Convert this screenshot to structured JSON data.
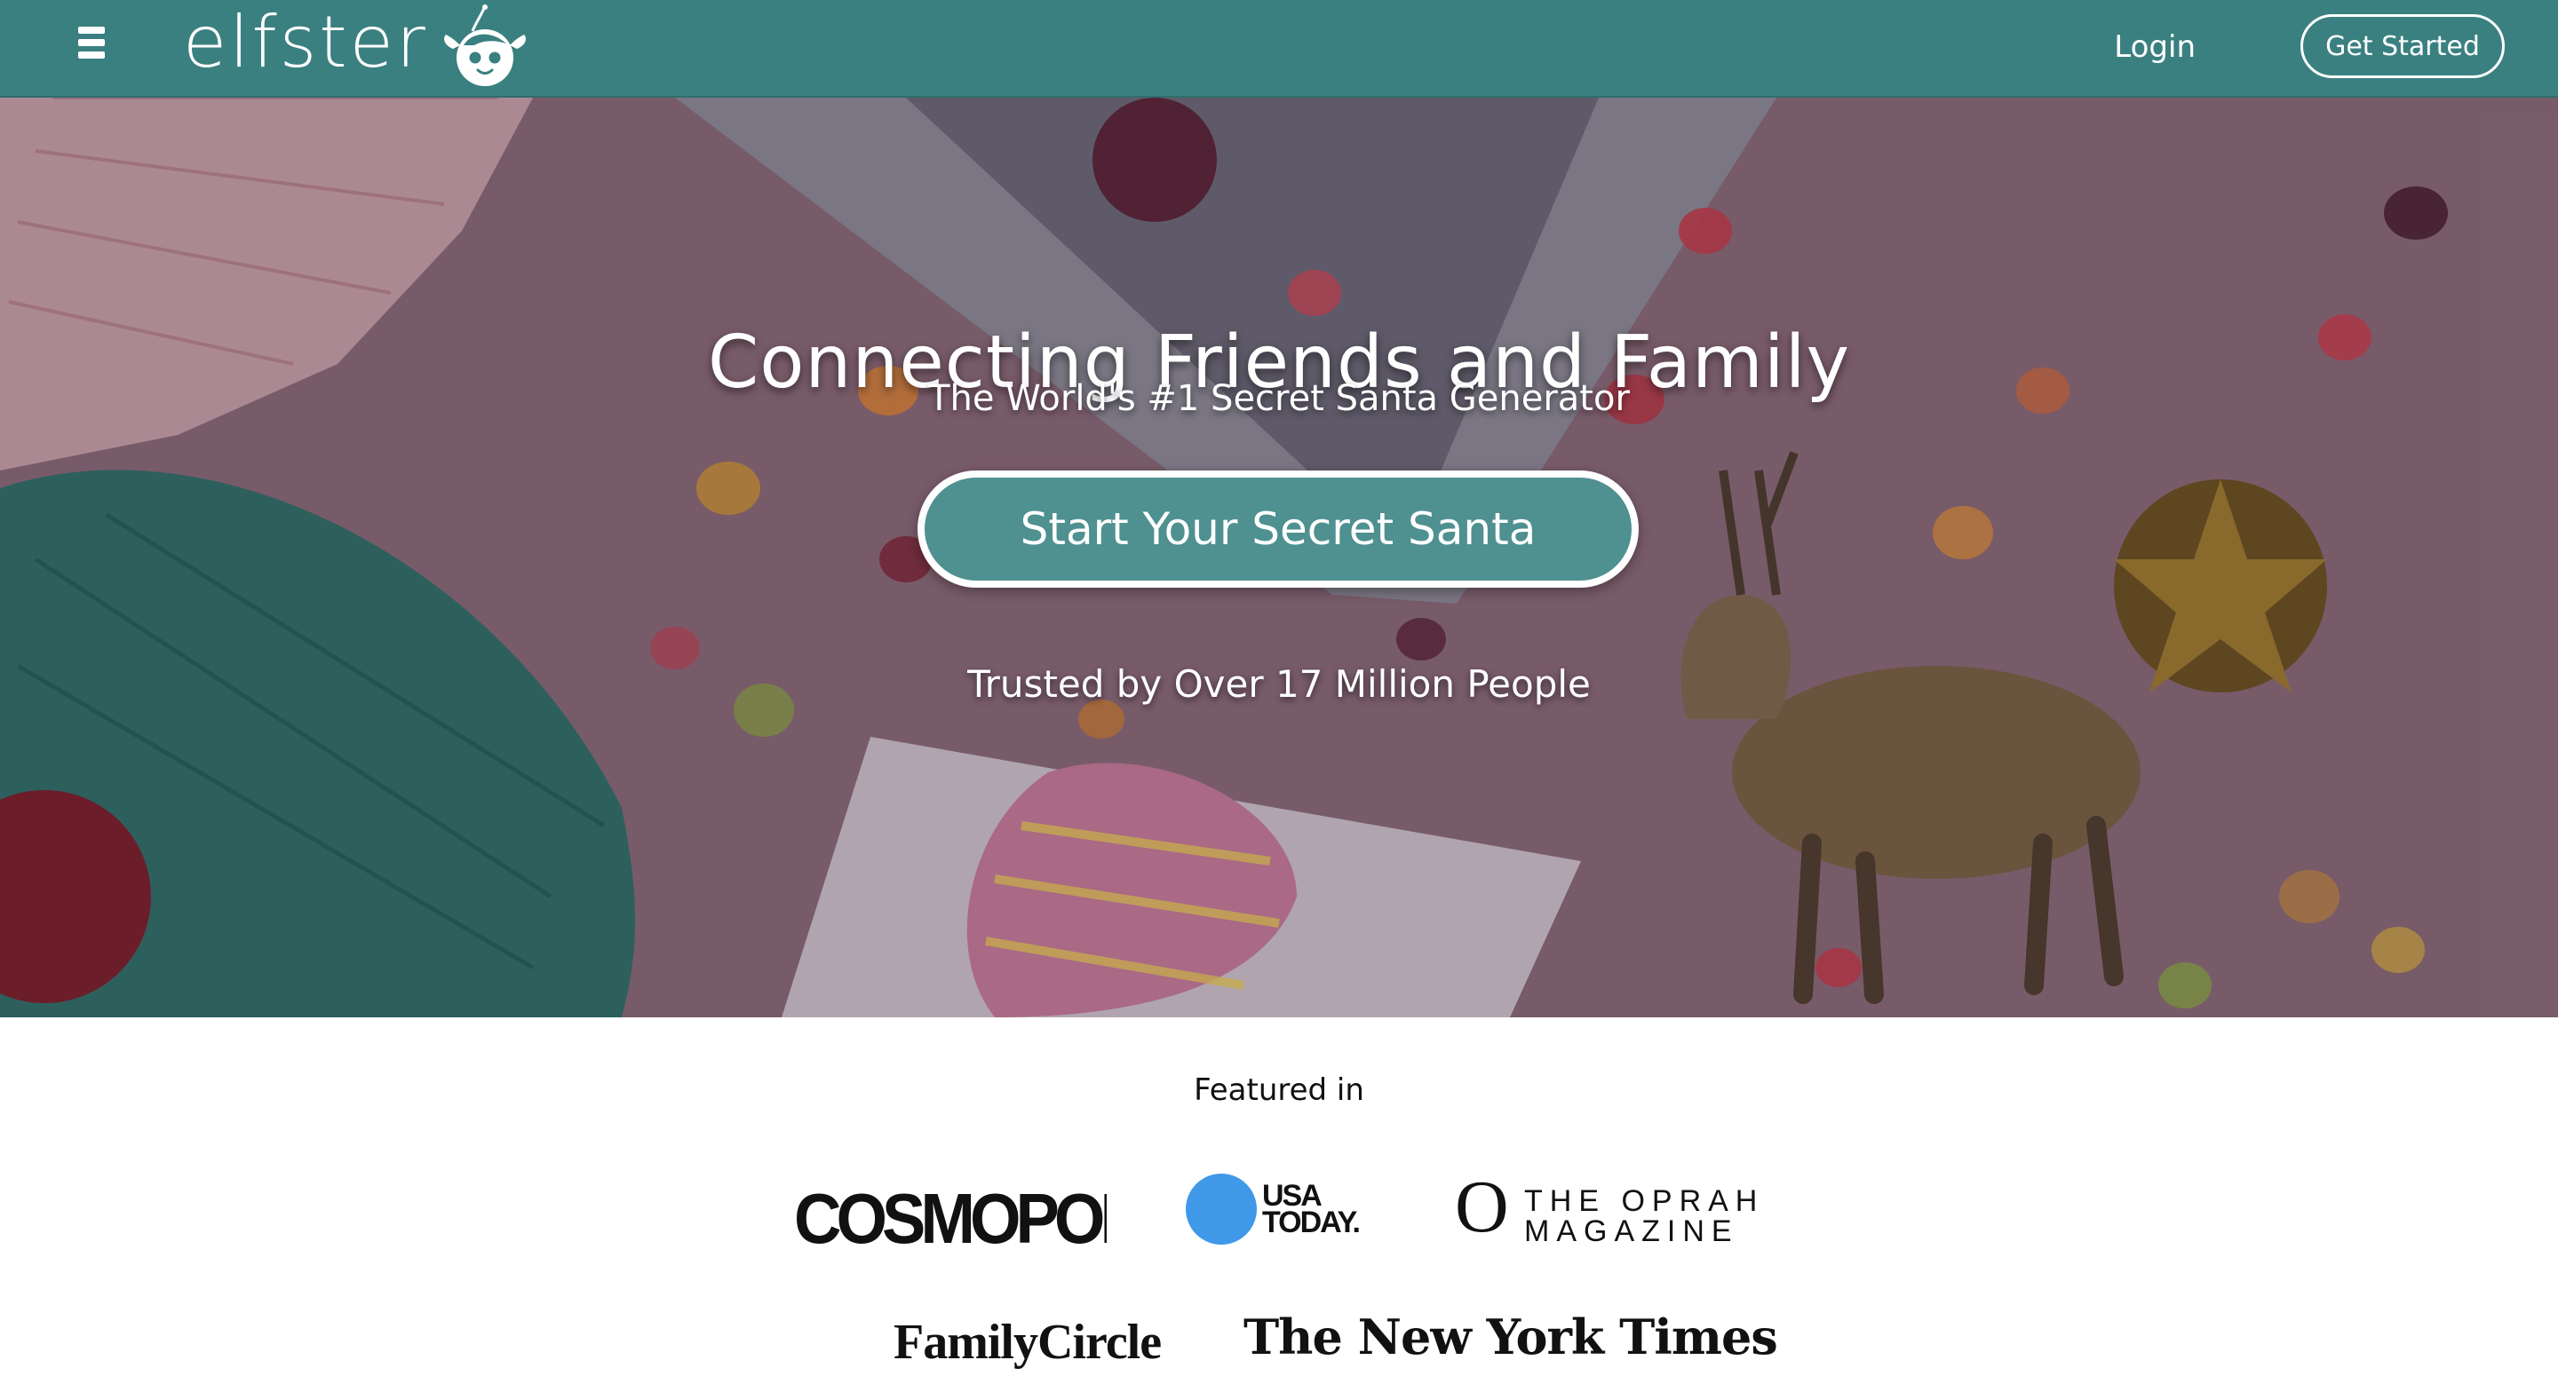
{
  "header": {
    "logo_text": "elfster",
    "logo_mascot_icon": "elf-mascot-icon",
    "menu_icon": "hamburger-menu-icon",
    "login_label": "Login",
    "get_started_label": "Get Started",
    "bar_color": "#3b8080"
  },
  "hero": {
    "title": "Connecting Friends and Family",
    "subtitle": "The World's #1 Secret Santa Generator",
    "cta_label": "Start Your Secret Santa",
    "trust_text": "Trusted by Over 17 Million People",
    "cta_color": "#4f9090"
  },
  "featured": {
    "label": "Featured in",
    "publications": [
      {
        "name": "COSMOPOLITAN"
      },
      {
        "name": "USA TODAY",
        "line1": "USA",
        "line2": "TODAY.",
        "accent": "#3f99e8"
      },
      {
        "name": "O THE OPRAH MAGAZINE",
        "letter": "O",
        "line1": "THE OPRAH",
        "line2": "MAGAZINE"
      },
      {
        "name": "FamilyCircle"
      },
      {
        "name": "The New York Times"
      }
    ]
  }
}
